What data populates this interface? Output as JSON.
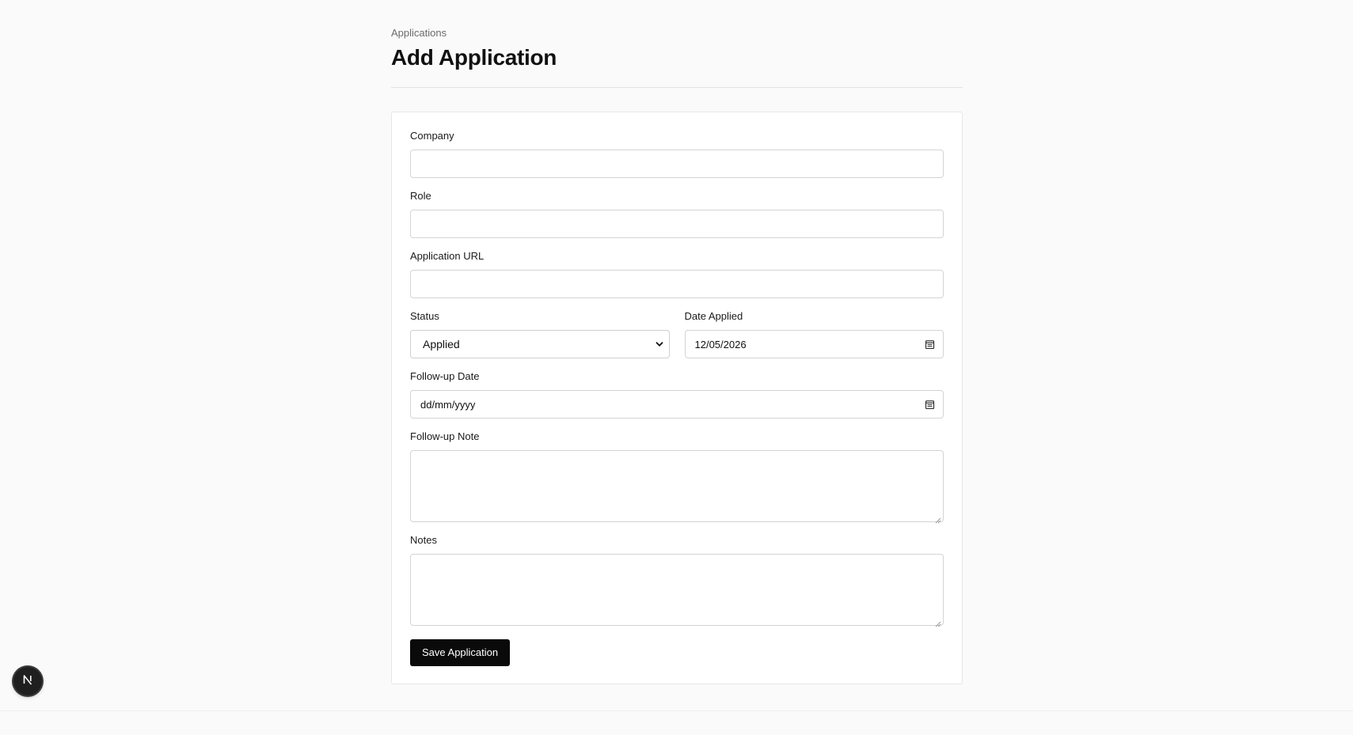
{
  "breadcrumb": "Applications",
  "page_title": "Add Application",
  "form": {
    "company": {
      "label": "Company",
      "value": ""
    },
    "role": {
      "label": "Role",
      "value": ""
    },
    "application_url": {
      "label": "Application URL",
      "value": ""
    },
    "status": {
      "label": "Status",
      "selected": "Applied"
    },
    "date_applied": {
      "label": "Date Applied",
      "value": "12/05/2026"
    },
    "follow_up_date": {
      "label": "Follow-up Date",
      "placeholder": "dd/mm/yyyy"
    },
    "follow_up_note": {
      "label": "Follow-up Note",
      "value": ""
    },
    "notes": {
      "label": "Notes",
      "value": ""
    },
    "save_label": "Save Application"
  },
  "dev_badge": {
    "letter": "N",
    "icon": "nextjs-icon"
  },
  "colors": {
    "background": "#fafafa",
    "card": "#ffffff",
    "button": "#0a0a0a",
    "button_text": "#ffffff",
    "border": "#d4d4d4"
  }
}
